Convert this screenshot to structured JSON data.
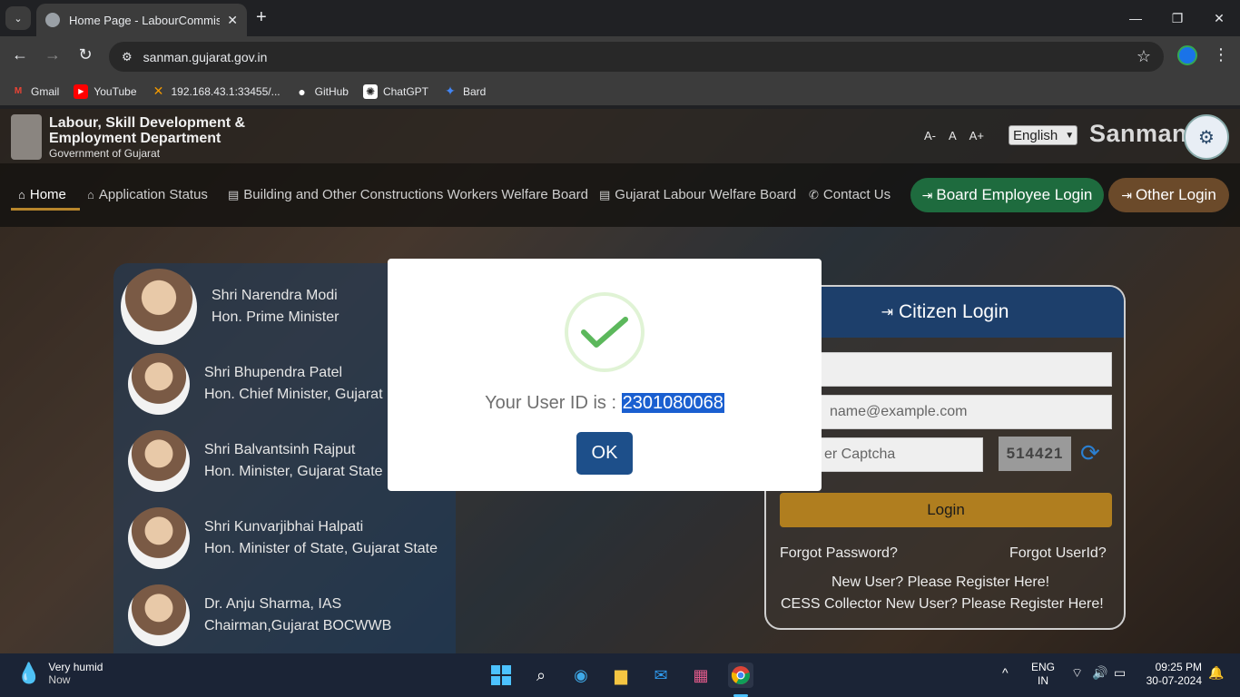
{
  "browser": {
    "tab_title": "Home Page - LabourCommission",
    "tab_close": "✕",
    "new_tab": "+",
    "url": "sanman.gujarat.gov.in",
    "bookmarks": [
      {
        "label": "Gmail",
        "icon": "gmail-icon",
        "color": "#ea4335",
        "glyph": "M"
      },
      {
        "label": "YouTube",
        "icon": "youtube-icon",
        "color": "#ff0000",
        "glyph": "▶"
      },
      {
        "label": "192.168.43.1:33455/...",
        "icon": "x-shaped-icon",
        "color": "#f29900",
        "glyph": "✕"
      },
      {
        "label": "GitHub",
        "icon": "github-icon",
        "color": "#555555",
        "glyph": "●"
      },
      {
        "label": "ChatGPT",
        "icon": "chatgpt-icon",
        "color": "#444444",
        "glyph": "✺"
      },
      {
        "label": "Bard",
        "icon": "bard-sparkle-icon",
        "color": "#4285f4",
        "glyph": "✦"
      }
    ]
  },
  "site": {
    "dept_title_line1": "Labour, Skill Development &",
    "dept_title_line2": "Employment Department",
    "dept_sub": "Government of Gujarat",
    "font_small": "A-",
    "font_normal": "A",
    "font_large": "A+",
    "language": "English",
    "brand": "Sanman",
    "nav": {
      "home": "Home",
      "application_status": "Application Status",
      "bocw": "Building and Other Constructions Workers Welfare Board",
      "glwb": "Gujarat Labour Welfare Board",
      "contact": "Contact Us",
      "board_login": "Board Employee Login",
      "other_login": "Other Login"
    },
    "leaders": [
      {
        "name": "Shri Narendra Modi",
        "title": "Hon. Prime Minister"
      },
      {
        "name": "Shri Bhupendra Patel",
        "title": "Hon. Chief Minister, Gujarat"
      },
      {
        "name": "Shri Balvantsinh Rajput",
        "title": "Hon. Minister, Gujarat State"
      },
      {
        "name": "Shri Kunvarjibhai Halpati",
        "title": "Hon. Minister of State, Gujarat State"
      },
      {
        "name": "Dr. Anju Sharma, IAS",
        "title": "Chairman,Gujarat BOCWWB"
      }
    ],
    "login": {
      "header": "Citizen Login",
      "email_placeholder": "name@example.com",
      "captcha_placeholder": "er Captcha",
      "captcha_text": "514421",
      "login_button": "Login",
      "forgot_password": "Forgot Password?",
      "forgot_userid": "Forgot UserId?",
      "new_user": "New User?  Please Register Here!",
      "cess_new_user": "CESS Collector New User?  Please Register Here!"
    }
  },
  "modal": {
    "message_prefix": "Your User ID is : ",
    "user_id": "2301080068",
    "ok_button": "OK"
  },
  "taskbar": {
    "weather_line1": "Very humid",
    "weather_line2": "Now",
    "lang_line1": "ENG",
    "lang_line2": "IN",
    "time": "09:25 PM",
    "date": "30-07-2024"
  }
}
